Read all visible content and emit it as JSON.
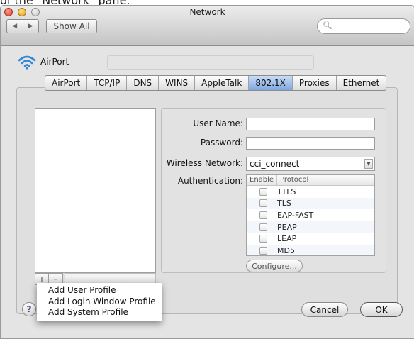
{
  "page_caption": "of the \"Network\" pane.",
  "window": {
    "title": "Network"
  },
  "toolbar": {
    "back_arrow": "◀",
    "forward_arrow": "▶",
    "show_all_label": "Show All",
    "search_placeholder": ""
  },
  "service": {
    "name": "AirPort",
    "icon": "wifi-icon"
  },
  "tabs": [
    {
      "label": "AirPort",
      "selected": false
    },
    {
      "label": "TCP/IP",
      "selected": false
    },
    {
      "label": "DNS",
      "selected": false
    },
    {
      "label": "WINS",
      "selected": false
    },
    {
      "label": "AppleTalk",
      "selected": false
    },
    {
      "label": "802.1X",
      "selected": true
    },
    {
      "label": "Proxies",
      "selected": false
    },
    {
      "label": "Ethernet",
      "selected": false
    }
  ],
  "profile_list": {
    "add_symbol": "+",
    "remove_symbol": "–"
  },
  "form": {
    "user_name_label": "User Name:",
    "user_name_value": "",
    "password_label": "Password:",
    "password_value": "",
    "wireless_network_label": "Wireless Network:",
    "wireless_network_value": "cci_connect",
    "authentication_label": "Authentication:",
    "auth_table": {
      "header_enable": "Enable",
      "header_protocol": "Protocol",
      "protocols": [
        {
          "name": "TTLS",
          "enabled": false
        },
        {
          "name": "TLS",
          "enabled": false
        },
        {
          "name": "EAP-FAST",
          "enabled": false
        },
        {
          "name": "PEAP",
          "enabled": false
        },
        {
          "name": "LEAP",
          "enabled": false
        },
        {
          "name": "MD5",
          "enabled": false
        }
      ]
    },
    "configure_label": "Configure..."
  },
  "add_menu": {
    "items": [
      "Add User Profile",
      "Add Login Window Profile",
      "Add System Profile"
    ]
  },
  "footer": {
    "help_symbol": "?",
    "cancel_label": "Cancel",
    "ok_label": "OK"
  },
  "colors": {
    "selected_tab": "#7ea7df",
    "wifi_icon": "#2f86d6"
  }
}
